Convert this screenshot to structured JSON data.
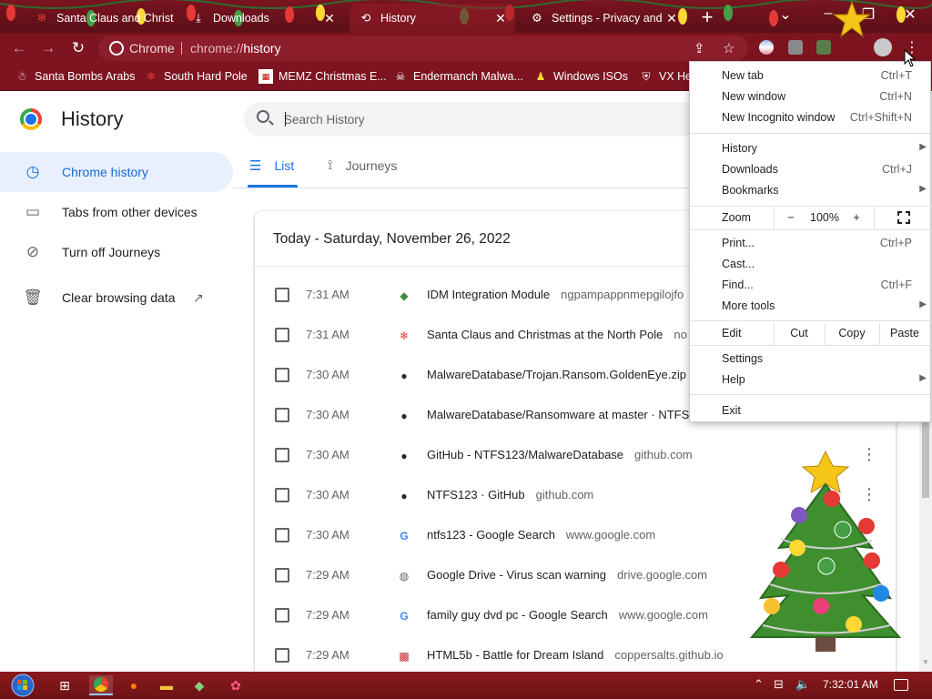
{
  "tabs": [
    {
      "title": "Santa Claus and Christ",
      "icon": "snowflake-icon"
    },
    {
      "title": "Downloads",
      "icon": "download-icon"
    },
    {
      "title": "History",
      "icon": "history-icon"
    },
    {
      "title": "Settings - Privacy and",
      "icon": "gear-icon"
    }
  ],
  "omnibox": {
    "scheme_label": "Chrome",
    "url_scheme": "chrome://",
    "url_host": "history"
  },
  "bookmarks": [
    {
      "label": "Santa Bombs Arabs",
      "icon": "santa-icon"
    },
    {
      "label": "South Hard Pole",
      "icon": "snowflake-icon"
    },
    {
      "label": "MEMZ Christmas E...",
      "icon": "page-icon"
    },
    {
      "label": "Endermanch Malwa...",
      "icon": "skull-icon"
    },
    {
      "label": "Windows ISOs",
      "icon": "user-icon"
    },
    {
      "label": "VX He",
      "icon": "shield-icon"
    }
  ],
  "page": {
    "title": "History",
    "search_placeholder": "Search History",
    "sidebar": [
      {
        "label": "Chrome history",
        "icon": "clock-icon"
      },
      {
        "label": "Tabs from other devices",
        "icon": "devices-icon"
      },
      {
        "label": "Turn off Journeys",
        "icon": "journeys-off-icon"
      },
      {
        "label": "Clear browsing data",
        "icon": "trash-icon"
      }
    ],
    "view_tabs": [
      {
        "label": "List",
        "icon": "list-icon"
      },
      {
        "label": "Journeys",
        "icon": "journeys-icon"
      }
    ],
    "date_header": "Today - Saturday, November 26, 2022",
    "entries": [
      {
        "time": "7:31 AM",
        "title": "IDM Integration Module",
        "domain": "ngpampappnmepgilojfo",
        "icon": "idm-icon"
      },
      {
        "time": "7:31 AM",
        "title": "Santa Claus and Christmas at the North Pole",
        "domain": "no",
        "icon": "snowflake-icon"
      },
      {
        "time": "7:30 AM",
        "title": "MalwareDatabase/Trojan.Ransom.GoldenEye.zip",
        "domain": "",
        "icon": "github-icon"
      },
      {
        "time": "7:30 AM",
        "title": "MalwareDatabase/Ransomware at master · NTFS",
        "domain": "",
        "icon": "github-icon"
      },
      {
        "time": "7:30 AM",
        "title": "GitHub - NTFS123/MalwareDatabase",
        "domain": "github.com",
        "icon": "github-icon"
      },
      {
        "time": "7:30 AM",
        "title": "NTFS123 · GitHub",
        "domain": "github.com",
        "icon": "github-icon"
      },
      {
        "time": "7:30 AM",
        "title": "ntfs123 - Google Search",
        "domain": "www.google.com",
        "icon": "google-icon"
      },
      {
        "time": "7:29 AM",
        "title": "Google Drive - Virus scan warning",
        "domain": "drive.google.com",
        "icon": "globe-icon"
      },
      {
        "time": "7:29 AM",
        "title": "family guy dvd pc - Google Search",
        "domain": "www.google.com",
        "icon": "google-icon"
      },
      {
        "time": "7:29 AM",
        "title": "HTML5b - Battle for Dream Island",
        "domain": "coppersalts.github.io",
        "icon": "html5b-icon"
      }
    ]
  },
  "menu": {
    "new_tab": {
      "label": "New tab",
      "shortcut": "Ctrl+T"
    },
    "new_window": {
      "label": "New window",
      "shortcut": "Ctrl+N"
    },
    "incognito": {
      "label": "New Incognito window",
      "shortcut": "Ctrl+Shift+N"
    },
    "history": {
      "label": "History"
    },
    "downloads": {
      "label": "Downloads",
      "shortcut": "Ctrl+J"
    },
    "bookmarks": {
      "label": "Bookmarks"
    },
    "zoom": {
      "label": "Zoom",
      "minus": "−",
      "level": "100%",
      "plus": "+"
    },
    "print": {
      "label": "Print...",
      "shortcut": "Ctrl+P"
    },
    "cast": {
      "label": "Cast..."
    },
    "find": {
      "label": "Find...",
      "shortcut": "Ctrl+F"
    },
    "more_tools": {
      "label": "More tools"
    },
    "edit": {
      "label": "Edit",
      "cut": "Cut",
      "copy": "Copy",
      "paste": "Paste"
    },
    "settings": {
      "label": "Settings"
    },
    "help": {
      "label": "Help"
    },
    "exit": {
      "label": "Exit"
    }
  },
  "taskbar": {
    "clock": "7:32:01 AM"
  },
  "colors": {
    "accent": "#1a73e8",
    "titlebar": "#7d1420",
    "taskbar": "#7a1618"
  }
}
